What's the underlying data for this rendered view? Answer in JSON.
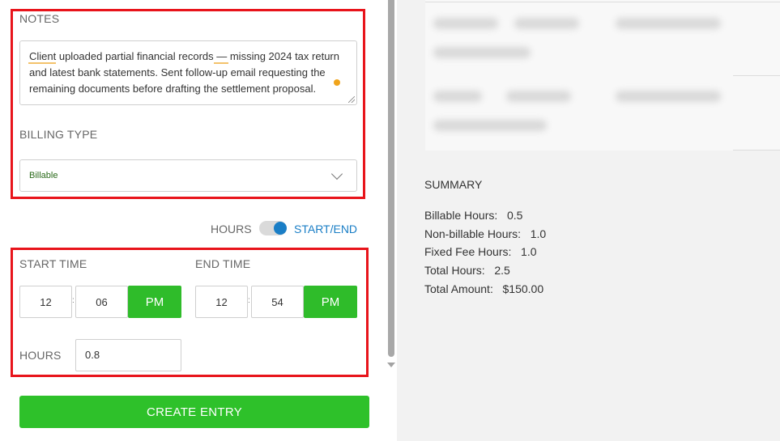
{
  "notes": {
    "label": "NOTES",
    "value": "Client uploaded partial financial records — missing 2024 tax return and latest bank statements. Sent follow-up email requesting the remaining documents before drafting the settlement proposal."
  },
  "billing": {
    "label": "BILLING TYPE",
    "selected": "Billable"
  },
  "mode_toggle": {
    "left_label": "HOURS",
    "right_label": "START/END",
    "state": "START/END"
  },
  "start_time": {
    "label": "START TIME",
    "hour": "12",
    "minute": "06",
    "ampm": "PM"
  },
  "end_time": {
    "label": "END TIME",
    "hour": "12",
    "minute": "54",
    "ampm": "PM"
  },
  "hours": {
    "label": "HOURS",
    "value": "0.8"
  },
  "create_button": "CREATE ENTRY",
  "summary": {
    "title": "SUMMARY",
    "rows": [
      {
        "label": "Billable Hours:",
        "value": "0.5"
      },
      {
        "label": "Non-billable Hours:",
        "value": "1.0"
      },
      {
        "label": "Fixed Fee Hours:",
        "value": "1.0"
      },
      {
        "label": "Total Hours:",
        "value": "2.5"
      },
      {
        "label": "Total Amount:",
        "value": "$150.00"
      }
    ]
  },
  "colors": {
    "highlight": "#e8141b",
    "primary_green": "#2fbc2a",
    "toggle_blue": "#1a7ec6"
  }
}
